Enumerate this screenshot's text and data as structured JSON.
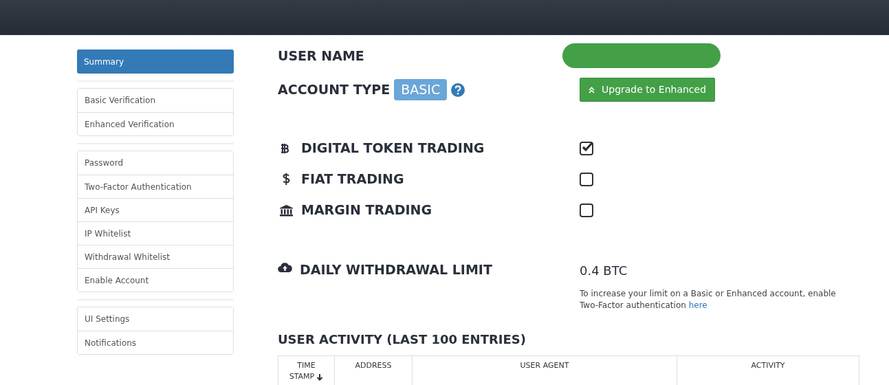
{
  "sidebar": {
    "groups": [
      [
        {
          "label": "Summary",
          "selected": true
        }
      ],
      [
        {
          "label": "Basic Verification",
          "selected": false
        },
        {
          "label": "Enhanced Verification",
          "selected": false
        }
      ],
      [
        {
          "label": "Password",
          "selected": false
        },
        {
          "label": "Two-Factor Authentication",
          "selected": false
        },
        {
          "label": "API Keys",
          "selected": false
        },
        {
          "label": "IP Whitelist",
          "selected": false
        },
        {
          "label": "Withdrawal Whitelist",
          "selected": false
        },
        {
          "label": "Enable Account",
          "selected": false
        }
      ],
      [
        {
          "label": "UI Settings",
          "selected": false
        },
        {
          "label": "Notifications",
          "selected": false
        }
      ]
    ]
  },
  "user_name": {
    "label": "USER NAME"
  },
  "account_type": {
    "label": "ACCOUNT TYPE",
    "badge": "BASIC",
    "upgrade_button": "Upgrade to Enhanced"
  },
  "permissions": [
    {
      "kind": "token",
      "label": "DIGITAL TOKEN TRADING",
      "checked": true
    },
    {
      "kind": "fiat",
      "label": "FIAT TRADING",
      "checked": false
    },
    {
      "kind": "margin",
      "label": "MARGIN TRADING",
      "checked": false
    }
  ],
  "withdrawal_limit": {
    "label": "DAILY WITHDRAWAL LIMIT",
    "value": "0.4 BTC",
    "note": "To increase your limit on a Basic or Enhanced account, enable Two-Factor authentication",
    "link": "here"
  },
  "activity": {
    "title": "USER ACTIVITY (LAST 100 ENTRIES)",
    "columns": [
      {
        "label": "TIME STAMP",
        "sorted": true
      },
      {
        "label": "ADDRESS",
        "sorted": false
      },
      {
        "label": "USER AGENT",
        "sorted": false
      },
      {
        "label": "ACTIVITY",
        "sorted": false
      }
    ]
  }
}
